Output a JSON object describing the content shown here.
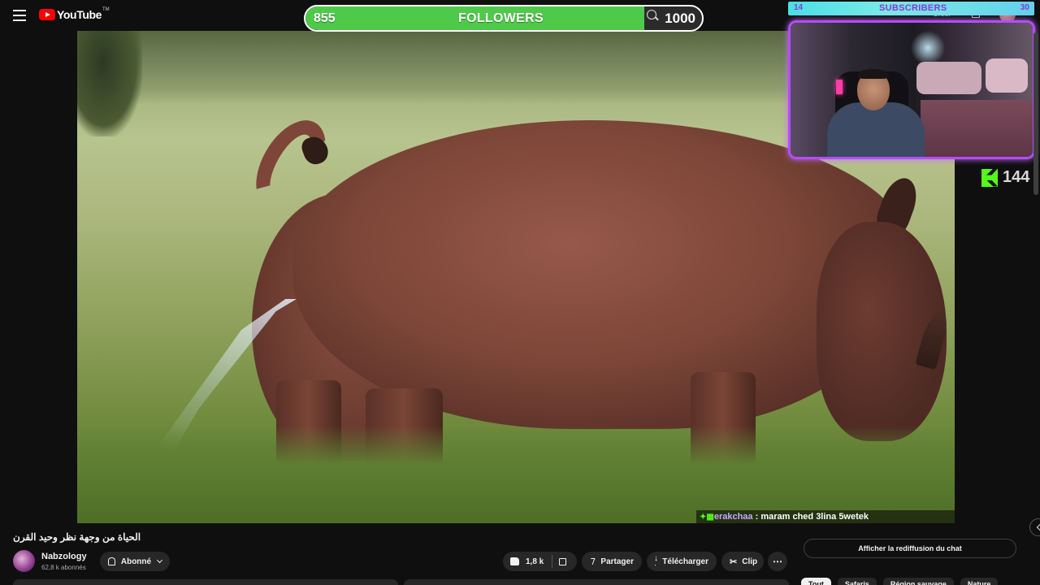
{
  "header": {
    "logo_text": "YouTube",
    "logo_tm": "TM",
    "create_label": "Créer"
  },
  "followers_goal": {
    "current": "855",
    "label": "FOLLOWERS",
    "goal": "1000",
    "progress": 0.855,
    "fill_color": "#4fc94a"
  },
  "subscribers_goal": {
    "current": "14",
    "label": "SUBSCRIBERS",
    "goal": "30",
    "bar_color": "#5fe0e6",
    "text_color": "#8a37d8"
  },
  "kick": {
    "count": "144",
    "color": "#53fc18"
  },
  "chat_overlay": {
    "username": "erakchaa",
    "separator": " : ",
    "message": "maram ched 3lina 5wetek"
  },
  "video": {
    "title": "الحياة من وجهة نظر وحيد القرن"
  },
  "channel": {
    "name": "Nabzology",
    "subscribers": "62,8 k abonnés",
    "subscribe_state": "Abonné"
  },
  "actions": {
    "likes": "1,8 k",
    "share": "Partager",
    "download": "Télécharger",
    "clip": "Clip",
    "more": "⋯"
  },
  "chat_replay": {
    "label": "Afficher la rediffusion du chat"
  },
  "chips": [
    {
      "label": "Tout",
      "active": true
    },
    {
      "label": "Safaris"
    },
    {
      "label": "Région sauvage"
    },
    {
      "label": "Nature"
    }
  ]
}
